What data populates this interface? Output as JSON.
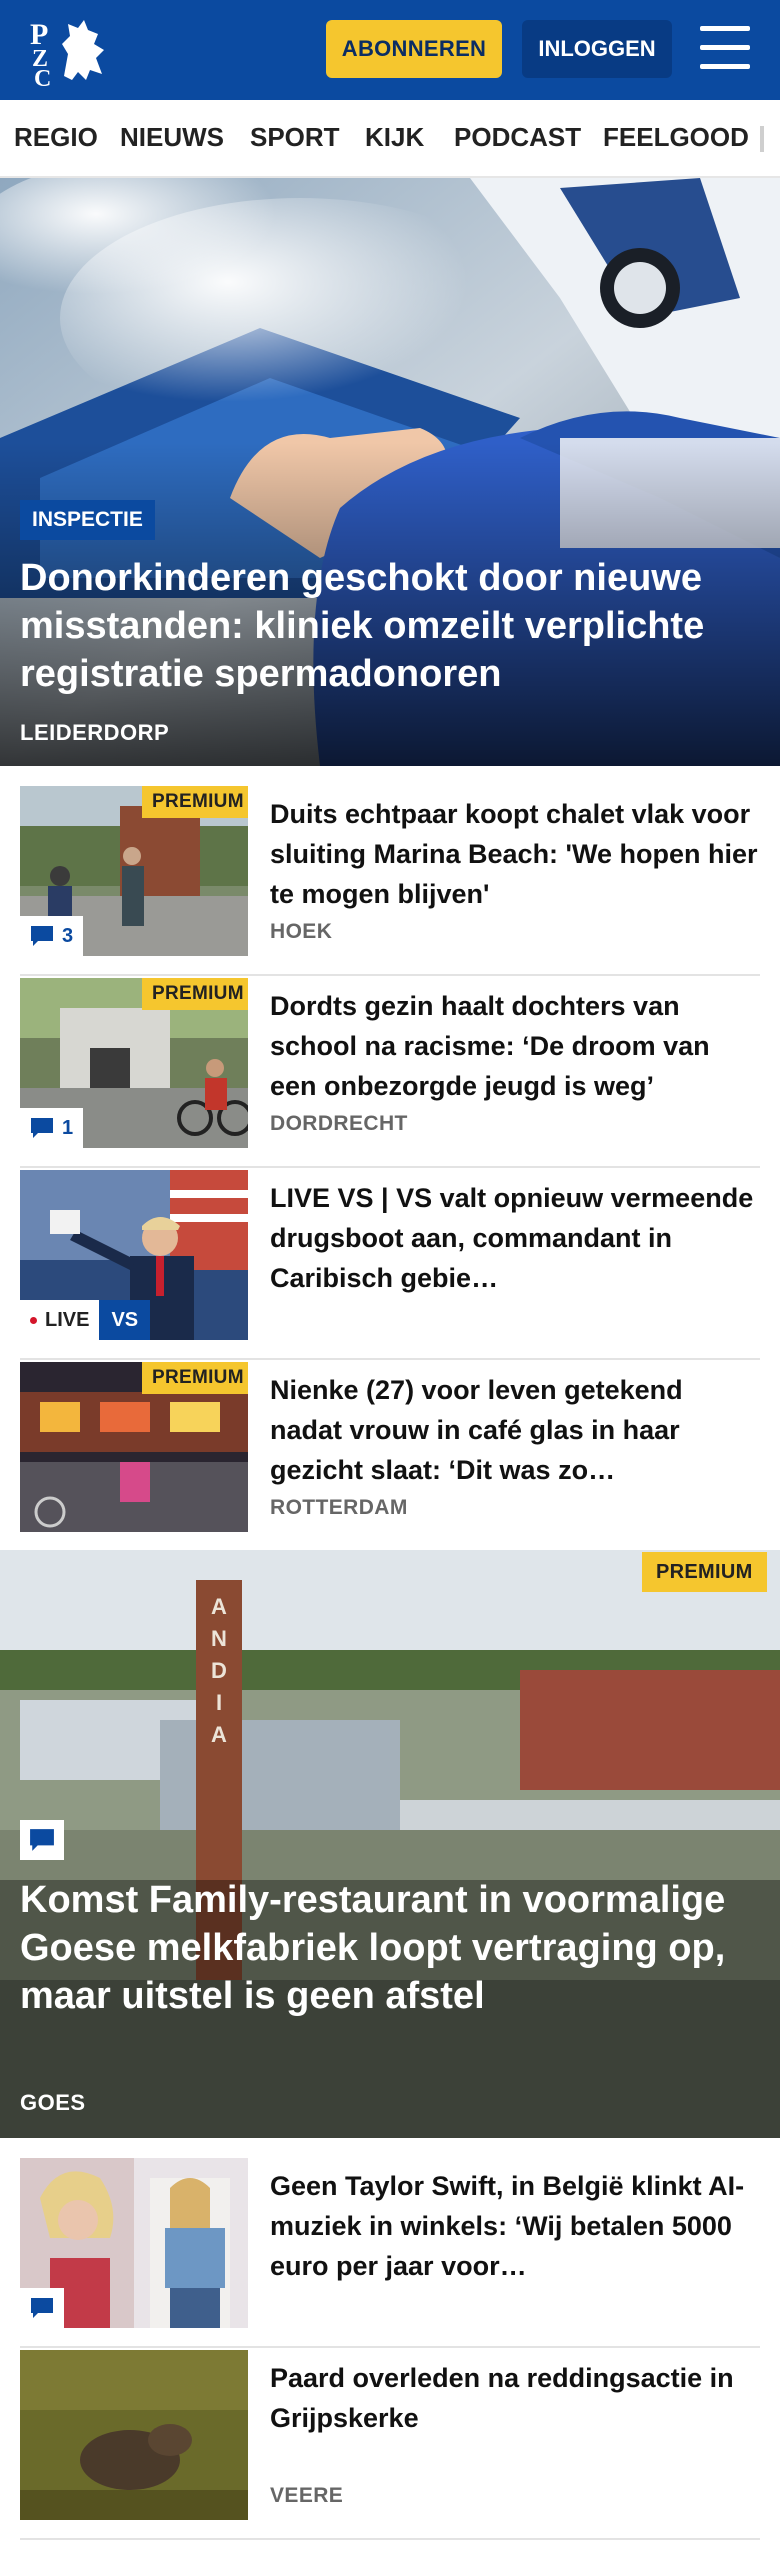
{
  "header": {
    "subscribe_label": "ABONNEREN",
    "login_label": "INLOGGEN",
    "brand_color": "#0b4aa0",
    "accent_color": "#f5c62e"
  },
  "nav": {
    "items": [
      "REGIO",
      "NIEUWS",
      "SPORT",
      "KIJK",
      "PODCAST",
      "FEELGOOD"
    ]
  },
  "hero": {
    "tag": "INSPECTIE",
    "title": "Donorkinderen geschokt door nieuwe misstanden: kliniek omzeilt verplichte registratie spermadonoren",
    "location": "LEIDERDORP"
  },
  "articles": [
    {
      "title": "Duits echtpaar koopt chalet vlak voor sluiting Marina Beach: 'We hopen hier te mogen blijven'",
      "location": "HOEK",
      "premium": "PREMIUM",
      "comments": "3"
    },
    {
      "title": "Dordts gezin haalt dochters van school na racisme: ‘De droom van een onbezorgde jeugd is weg’",
      "location": "DORDRECHT",
      "premium": "PREMIUM",
      "comments": "1"
    },
    {
      "title": "LIVE VS | VS valt opnieuw vermeende drugsboot aan, commandant in Caribisch gebie…",
      "live_label": "LIVE",
      "live_tag": "VS"
    },
    {
      "title": "Nienke (27) voor leven getekend nadat vrouw in café glas in haar gezicht slaat: ‘Dit was zo…",
      "location": "ROTTERDAM",
      "premium": "PREMIUM"
    }
  ],
  "feature": {
    "premium": "PREMIUM",
    "title": "Komst Family-restaurant in voormalige Goese melkfabriek loopt vertraging op, maar uitstel is geen afstel",
    "location": "GOES",
    "chimney_text": "ANDIA"
  },
  "articles2": [
    {
      "title": "Geen Taylor Swift, in België klinkt AI-muziek in winkels: ‘Wij betalen 5000 euro per jaar voor…"
    },
    {
      "title": "Paard overleden na reddingsac­tie in Grijpskerke",
      "location": "VEERE"
    }
  ],
  "icons": [
    "pzc-logo-icon",
    "hamburger-menu-icon",
    "comment-icon"
  ]
}
